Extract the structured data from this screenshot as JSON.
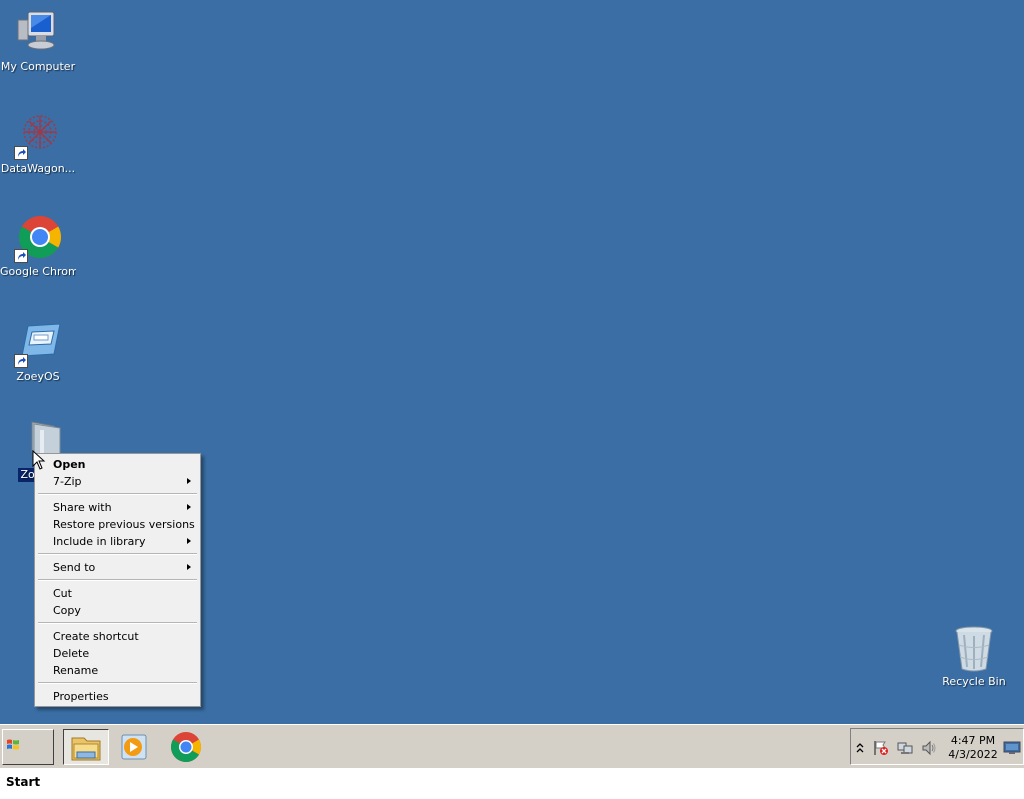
{
  "desktop": {
    "background": "#3a6ea5",
    "icons": [
      {
        "label": "My Computer",
        "icon": "computer-icon"
      },
      {
        "label": "DataWagon...",
        "icon": "datawagon-icon",
        "shortcut": true
      },
      {
        "label": "Google Chrome",
        "icon": "chrome-icon",
        "shortcut": true
      },
      {
        "label": "ZoeyOS",
        "icon": "zoeyos-icon",
        "shortcut": true
      },
      {
        "label": "Zoe",
        "icon": "folder-icon",
        "selected": true
      },
      {
        "label": "Recycle Bin",
        "icon": "recycle-bin-icon"
      }
    ]
  },
  "context_menu": {
    "items": [
      {
        "label": "Open",
        "bold": true
      },
      {
        "label": "7-Zip",
        "submenu": true
      },
      {
        "label": "Share with",
        "submenu": true
      },
      {
        "label": "Restore previous versions"
      },
      {
        "label": "Include in library",
        "submenu": true
      },
      {
        "label": "Send to",
        "submenu": true
      },
      {
        "label": "Cut"
      },
      {
        "label": "Copy"
      },
      {
        "label": "Create shortcut"
      },
      {
        "label": "Delete"
      },
      {
        "label": "Rename"
      },
      {
        "label": "Properties"
      }
    ]
  },
  "taskbar": {
    "start_label": "Start",
    "apps": [
      {
        "name": "file-explorer-icon"
      },
      {
        "name": "media-player-icon"
      },
      {
        "name": "chrome-icon"
      }
    ],
    "tray": {
      "clock_time": "4:47 PM",
      "clock_date": "4/3/2022",
      "icons": [
        "show-hidden-icons-chevron",
        "action-center-flag-icon",
        "network-icon",
        "volume-icon",
        "show-desktop-icon"
      ]
    }
  }
}
